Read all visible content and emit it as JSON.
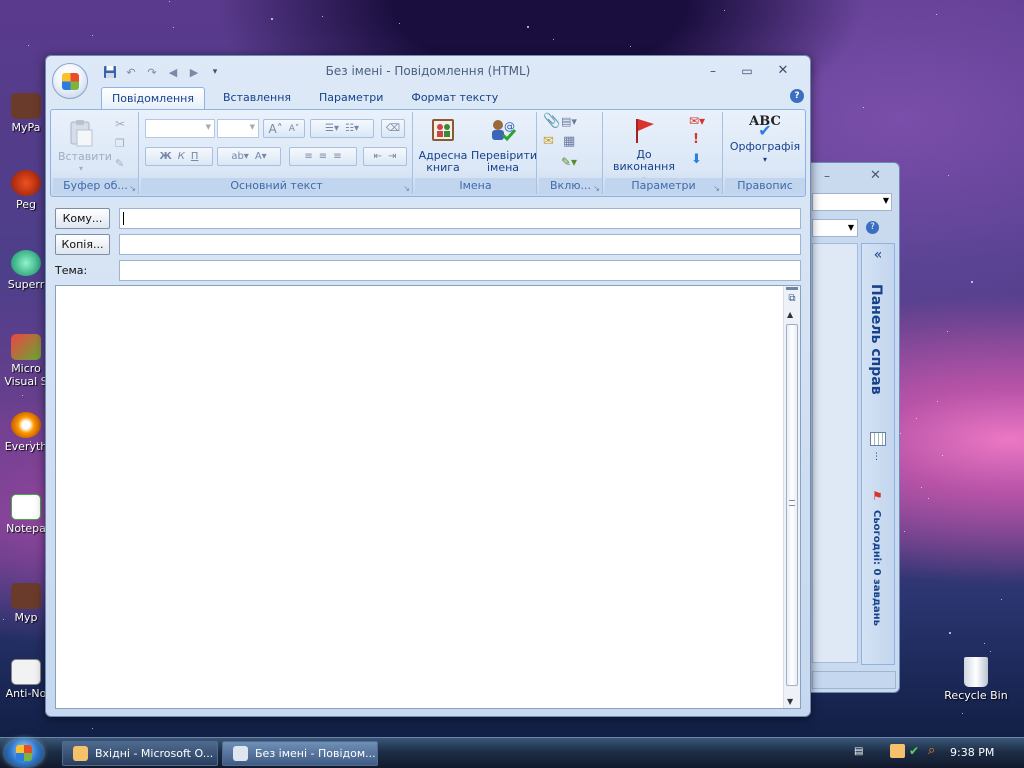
{
  "desktop": {
    "icons": [
      {
        "id": "myp1",
        "label": "MyPa"
      },
      {
        "id": "peg",
        "label": "Peg"
      },
      {
        "id": "super",
        "label": "Superr"
      },
      {
        "id": "msvs",
        "label": "Micro\nVisual S"
      },
      {
        "id": "every",
        "label": "Everyth"
      },
      {
        "id": "notepad",
        "label": "Notepa"
      },
      {
        "id": "myp2",
        "label": "Myp"
      },
      {
        "id": "anti",
        "label": "Anti-No"
      }
    ],
    "recycle_bin": "Recycle Bin"
  },
  "back_window": {
    "taskpane_title": "Панель справ",
    "today_tasks": "Сьогодні: 0 завдань",
    "collapse": "«"
  },
  "window": {
    "title": "Без імені - Повідомлення (HTML)",
    "qat": [
      "save-icon",
      "undo-icon",
      "redo-icon",
      "arrow-left-icon",
      "arrow-right-icon",
      "qat-dropdown-icon"
    ],
    "tabs": [
      "Повідомлення",
      "Вставлення",
      "Параметри",
      "Формат тексту"
    ],
    "selected_tab": "Повідомлення",
    "ribbon": {
      "clipboard": {
        "label": "Буфер об...",
        "paste": "Вставити"
      },
      "basic_text": {
        "label": "Основний текст",
        "bold": "Ж",
        "italic": "К",
        "underline": "П"
      },
      "names": {
        "label": "Імена",
        "address_book": "Адресна книга",
        "check_names": "Перевірити імена"
      },
      "include": {
        "label": "Вклю..."
      },
      "options": {
        "label": "Параметри",
        "follow_up": "До виконання"
      },
      "proofing": {
        "label": "Правопис",
        "spelling": "Орфографія",
        "abc": "ABC"
      }
    },
    "fields": {
      "to_label": "Кому...",
      "cc_label": "Копія...",
      "subject_label": "Тема:",
      "to_value": "",
      "cc_value": "",
      "subject_value": ""
    },
    "body_text": ""
  },
  "taskbar": {
    "items": [
      {
        "label": "Вхідні - Microsoft O...",
        "active": false
      },
      {
        "label": "Без імені - Повідом...",
        "active": true
      }
    ],
    "clock": "9:38 PM"
  },
  "colors": {
    "ribbon_text": "#15428b",
    "group_label": "#3e6aaa",
    "flag": "#d9342b",
    "accent": "#2b7de2"
  }
}
